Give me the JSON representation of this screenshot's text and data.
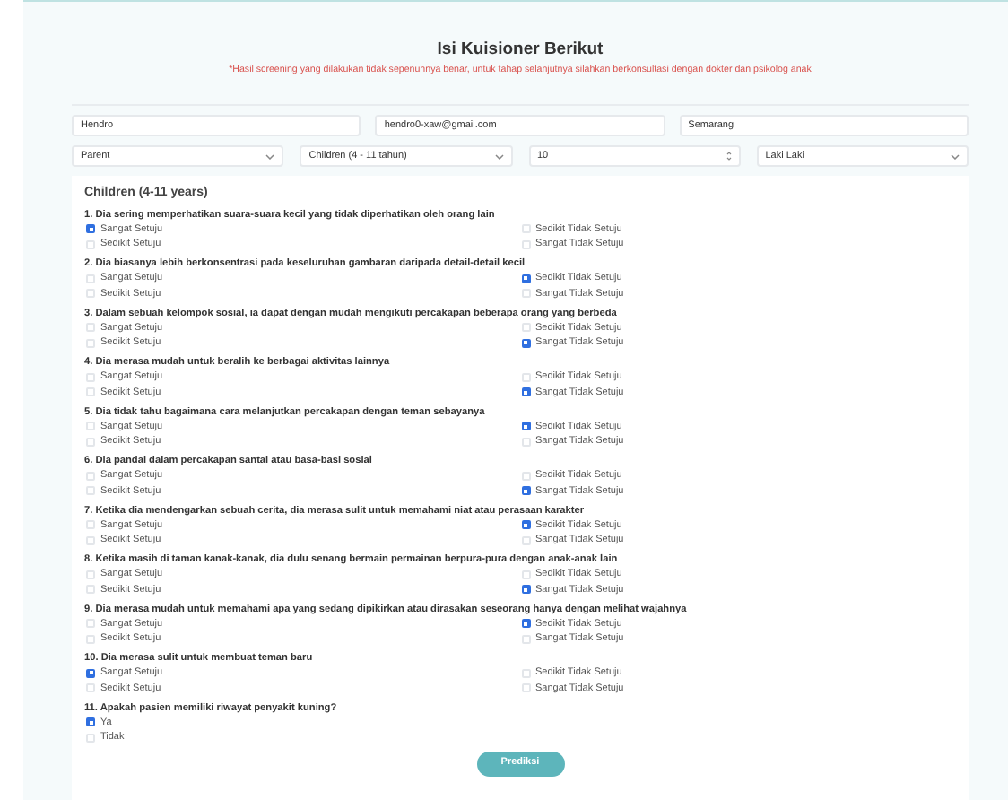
{
  "title": "Isi Kuisioner Berikut",
  "notice": "*Hasil screening yang dilakukan tidak sepenuhnya benar, untuk tahap selanjutnya silahkan berkonsultasi dengan dokter dan psikolog anak",
  "fields": [
    {
      "value": "Hendro"
    },
    {
      "value": "hendro0-xaw@gmail.com"
    },
    {
      "value": "Semarang"
    }
  ],
  "selects": [
    {
      "kind": "dropdown",
      "value": "Parent"
    },
    {
      "kind": "dropdown",
      "value": "Children (4 - 11 tahun)"
    },
    {
      "kind": "number",
      "value": "10"
    },
    {
      "kind": "dropdown",
      "value": "Laki Laki"
    }
  ],
  "section_title": "Children (4-11 years)",
  "questions": [
    {
      "kind": "grid",
      "text": "1. Dia sering memperhatikan suara-suara kecil yang tidak diperhatikan oleh orang lain",
      "options": [
        {
          "label": "Sangat Setuju",
          "selected": true
        },
        {
          "label": "Sedikit Setuju",
          "selected": false
        },
        {
          "label": "Sedikit Tidak Setuju",
          "selected": false
        },
        {
          "label": "Sangat Tidak Setuju",
          "selected": false
        }
      ]
    },
    {
      "kind": "grid",
      "text": "2. Dia biasanya lebih berkonsentrasi pada keseluruhan gambaran daripada detail-detail kecil",
      "options": [
        {
          "label": "Sangat Setuju",
          "selected": false
        },
        {
          "label": "Sedikit Setuju",
          "selected": false
        },
        {
          "label": "Sedikit Tidak Setuju",
          "selected": true
        },
        {
          "label": "Sangat Tidak Setuju",
          "selected": false
        }
      ]
    },
    {
      "kind": "grid",
      "text": "3. Dalam sebuah kelompok sosial, ia dapat dengan mudah mengikuti percakapan beberapa orang yang berbeda",
      "options": [
        {
          "label": "Sangat Setuju",
          "selected": false
        },
        {
          "label": "Sedikit Setuju",
          "selected": false
        },
        {
          "label": "Sedikit Tidak Setuju",
          "selected": false
        },
        {
          "label": "Sangat Tidak Setuju",
          "selected": true
        }
      ]
    },
    {
      "kind": "grid",
      "text": "4. Dia merasa mudah untuk beralih ke berbagai aktivitas lainnya",
      "options": [
        {
          "label": "Sangat Setuju",
          "selected": false
        },
        {
          "label": "Sedikit Setuju",
          "selected": false
        },
        {
          "label": "Sedikit Tidak Setuju",
          "selected": false
        },
        {
          "label": "Sangat Tidak Setuju",
          "selected": true
        }
      ]
    },
    {
      "kind": "grid",
      "text": "5. Dia tidak tahu bagaimana cara melanjutkan percakapan dengan teman sebayanya",
      "options": [
        {
          "label": "Sangat Setuju",
          "selected": false
        },
        {
          "label": "Sedikit Setuju",
          "selected": false
        },
        {
          "label": "Sedikit Tidak Setuju",
          "selected": true
        },
        {
          "label": "Sangat Tidak Setuju",
          "selected": false
        }
      ]
    },
    {
      "kind": "grid",
      "text": "6. Dia pandai dalam percakapan santai atau basa-basi sosial",
      "options": [
        {
          "label": "Sangat Setuju",
          "selected": false
        },
        {
          "label": "Sedikit Setuju",
          "selected": false
        },
        {
          "label": "Sedikit Tidak Setuju",
          "selected": false
        },
        {
          "label": "Sangat Tidak Setuju",
          "selected": true
        }
      ]
    },
    {
      "kind": "grid",
      "text": "7. Ketika dia mendengarkan sebuah cerita, dia merasa sulit untuk memahami niat atau perasaan karakter",
      "options": [
        {
          "label": "Sangat Setuju",
          "selected": false
        },
        {
          "label": "Sedikit Setuju",
          "selected": false
        },
        {
          "label": "Sedikit Tidak Setuju",
          "selected": true
        },
        {
          "label": "Sangat Tidak Setuju",
          "selected": false
        }
      ]
    },
    {
      "kind": "grid",
      "text": "8. Ketika masih di taman kanak-kanak, dia dulu senang bermain permainan berpura-pura dengan anak-anak lain",
      "options": [
        {
          "label": "Sangat Setuju",
          "selected": false
        },
        {
          "label": "Sedikit Setuju",
          "selected": false
        },
        {
          "label": "Sedikit Tidak Setuju",
          "selected": false
        },
        {
          "label": "Sangat Tidak Setuju",
          "selected": true
        }
      ]
    },
    {
      "kind": "grid",
      "text": "9. Dia merasa mudah untuk memahami apa yang sedang dipikirkan atau dirasakan seseorang hanya dengan melihat wajahnya",
      "options": [
        {
          "label": "Sangat Setuju",
          "selected": false
        },
        {
          "label": "Sedikit Setuju",
          "selected": false
        },
        {
          "label": "Sedikit Tidak Setuju",
          "selected": true
        },
        {
          "label": "Sangat Tidak Setuju",
          "selected": false
        }
      ]
    },
    {
      "kind": "grid",
      "text": "10. Dia merasa sulit untuk membuat teman baru",
      "options": [
        {
          "label": "Sangat Setuju",
          "selected": true
        },
        {
          "label": "Sedikit Setuju",
          "selected": false
        },
        {
          "label": "Sedikit Tidak Setuju",
          "selected": false
        },
        {
          "label": "Sangat Tidak Setuju",
          "selected": false
        }
      ]
    },
    {
      "kind": "list",
      "text": "11. Apakah pasien memiliki riwayat penyakit kuning?",
      "options": [
        {
          "label": "Ya",
          "selected": true
        },
        {
          "label": "Tidak",
          "selected": false
        }
      ]
    }
  ],
  "submit": "Prediksi"
}
